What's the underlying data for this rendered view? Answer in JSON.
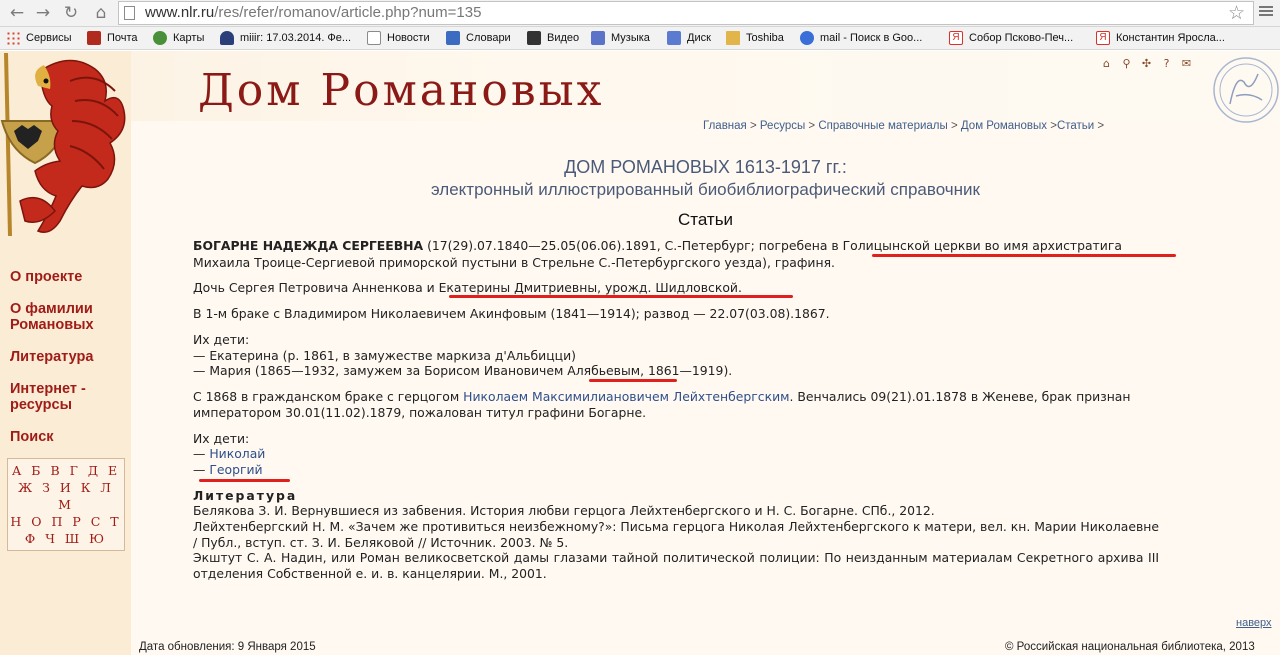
{
  "browser": {
    "url_host": "www.nlr.ru",
    "url_path": "/res/refer/romanov/article.php?num=135",
    "bookmarks": [
      {
        "label": "Сервисы",
        "icon": "apps-icon",
        "color": "#d9452b"
      },
      {
        "label": "Почта",
        "icon": "mail-icon",
        "color": "#b02a1e"
      },
      {
        "label": "Карты",
        "icon": "maps-icon",
        "color": "#4a8f3a"
      },
      {
        "label": "miiir: 17.03.2014. Фе...",
        "icon": "user-icon",
        "color": "#2a3f7a"
      },
      {
        "label": "Новости",
        "icon": "page-icon",
        "color": "#8a8a8a"
      },
      {
        "label": "Словари",
        "icon": "dictionary-icon",
        "color": "#3b6cc2"
      },
      {
        "label": "Видео",
        "icon": "video-icon",
        "color": "#333333"
      },
      {
        "label": "Музыка",
        "icon": "music-icon",
        "color": "#5a73c9"
      },
      {
        "label": "Диск",
        "icon": "disk-icon",
        "color": "#5b7bd0"
      },
      {
        "label": "Toshiba",
        "icon": "folder-icon",
        "color": "#e2b54a"
      },
      {
        "label": "mail - Поиск в Goo...",
        "icon": "search-icon",
        "color": "#3a6fd8"
      },
      {
        "label": "Собор Псково-Печ...",
        "icon": "yandex-icon",
        "color": "#d8322a"
      },
      {
        "label": "Константин Яросла...",
        "icon": "yandex-icon",
        "color": "#d8322a"
      }
    ]
  },
  "site": {
    "title": "Дом Романовых",
    "util_icons": [
      "home-icon",
      "search-icon",
      "sitemap-icon",
      "help-icon",
      "email-icon"
    ],
    "util_glyphs": [
      "⌂",
      "⚲",
      "✣",
      "?",
      "✉"
    ],
    "nav": [
      "О проекте",
      "О фамилии Романовых",
      "Литература",
      "Интернет - ресурсы",
      "Поиск"
    ],
    "alphabet": [
      "А Б В Г Д Е",
      "Ж З И К Л М",
      "Н О П Р С Т",
      "Ф Ч Ш Ю"
    ]
  },
  "breadcrumb": [
    {
      "label": "Главная",
      "sep": " > "
    },
    {
      "label": "Ресурсы",
      "sep": " > "
    },
    {
      "label": "Справочные материалы",
      "sep": " > "
    },
    {
      "label": "Дом Романовых",
      "sep": " >"
    },
    {
      "label": "Статьи",
      "sep": " >"
    }
  ],
  "heading": {
    "line1": "ДОМ РОМАНОВЫХ 1613-1917 гг.:",
    "line2": "электронный иллюстрированный биобиблиографический справочник",
    "section": "Статьи"
  },
  "article": {
    "name": "БОГАРНЕ НАДЕЖДА СЕРГЕЕВНА",
    "intro_1": " (17(29).07.1840—25.05(06.06).1891, С.-Петербург; погребена в Голицынской церкви во имя архистратига",
    "intro_2": "Михаила Троице-Сергиевой приморской пустыни в Стрельне С.-Петербургского уезда), графиня.",
    "daughter": "Дочь Сергея Петровича Анненкова и Екатерины Дмитриевны, урожд. Шидловской.",
    "first_marriage": "В 1-м браке с Владимиром Николаевичем Акинфовым (1841—1914); развод — 22.07(03.08).1867.",
    "children_label": "Их дети:",
    "child_1": "— Екатерина (р. 1861, в замужестве маркиза д'Альбицци)",
    "child_2": "— Мария (1865—1932, замужем за Борисом Ивановичем Алябьевым, 1861—1919).",
    "second_marriage_pre": "С 1868 в гражданском браке с герцогом ",
    "second_marriage_link": "Николаем Максимилиановичем Лейхтенбергским",
    "second_marriage_post": ". Венчались 09(21).01.1878 в Женеве, брак признан",
    "second_marriage_2": "императором 30.01(11.02).1879, пожалован титул графини Богарне.",
    "children2_label": "Их дети:",
    "dash": "— ",
    "child2_1": "Николай",
    "child2_2": "Георгий",
    "lit_heading": "Литература",
    "lit_1": "Белякова З. И. Вернувшиеся из забвения. История любви герцога Лейхтенбергского и Н. С. Богарне. СПб., 2012.",
    "lit_2": "Лейхтенбергский Н. М. «Зачем же противиться неизбежному?»: Письма герцога Николая Лейхтенбергского к матери, вел. кн. Марии Николаевне / Публ., вступ. ст. З. И. Беляковой // Источник. 2003. № 5.",
    "lit_3": "Экштут С. А. Надин, или Роман великосветской дамы глазами тайной политической полиции: По неизданным материалам Секретного архива III отделения Собственной е. и. в. канцелярии. М., 2001."
  },
  "footer": {
    "top_link": "наверх",
    "updated": "Дата обновления: 9 Января 2015",
    "copyright": "© Российская национальная библиотека, 2013"
  },
  "colors": {
    "accent_red": "#a01c17",
    "link_blue": "#2e4f8c",
    "underline_red": "#e0201c"
  }
}
